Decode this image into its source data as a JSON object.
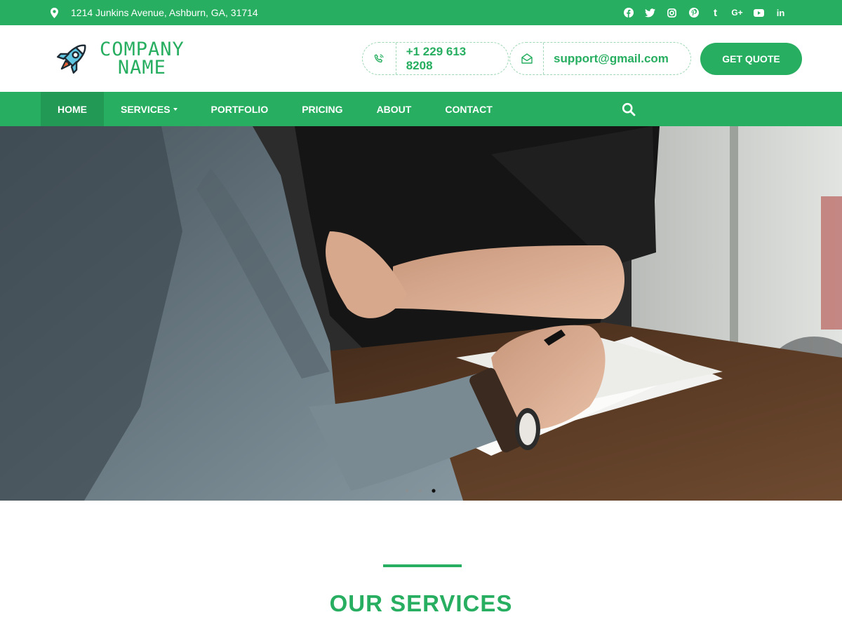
{
  "topbar": {
    "address": "1214 Junkins Avenue, Ashburn, GA, 31714",
    "social": [
      "facebook-icon",
      "twitter-icon",
      "instagram-icon",
      "pinterest-icon",
      "tumblr-icon",
      "google-plus-icon",
      "youtube-icon",
      "linkedin-icon"
    ],
    "tumblr_glyph": "t",
    "gplus_glyph": "G+",
    "linkedin_glyph": "in"
  },
  "header": {
    "logo_line1": "COMPANY",
    "logo_line2": "NAME",
    "phone": "+1 229 613 8208",
    "email": "support@gmail.com",
    "cta": "GET QUOTE"
  },
  "nav": {
    "items": [
      "HOME",
      "SERVICES",
      "PORTFOLIO",
      "PRICING",
      "ABOUT",
      "CONTACT"
    ],
    "active": "HOME"
  },
  "hero": {
    "slide_count": 3,
    "active_slide": 3
  },
  "services": {
    "heading": "OUR SERVICES"
  },
  "colors": {
    "brand": "#27ae60",
    "brand_dark": "#229954",
    "white": "#ffffff"
  }
}
